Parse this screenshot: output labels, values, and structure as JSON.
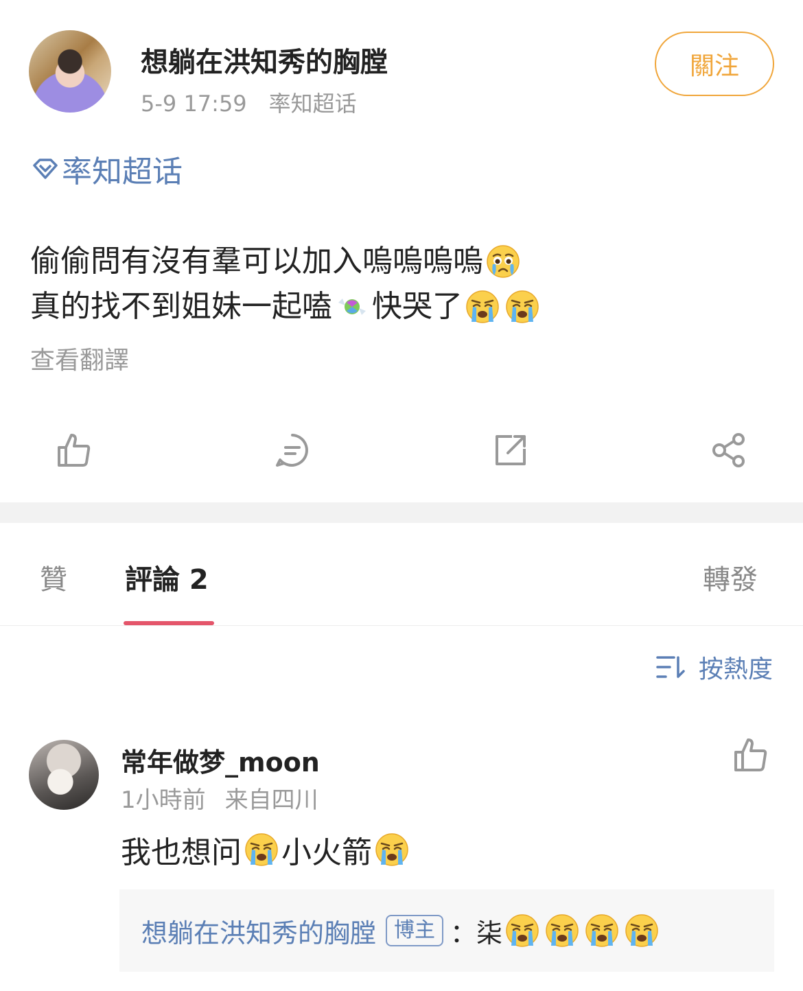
{
  "post": {
    "author_name": "想躺在洪知秀的胸膛",
    "time": "5-9 17:59",
    "source": "率知超话",
    "follow_label": "關注",
    "topic": "率知超话",
    "line1": "偷偷問有沒有羣可以加入嗚嗚嗚嗚",
    "line2a": "真的找不到姐妹一起嗑",
    "line2b": "快哭了",
    "translate_label": "查看翻譯",
    "action_icons": [
      "like-icon",
      "comment-icon",
      "repost-icon",
      "share-icon"
    ]
  },
  "tabs": {
    "likes_label": "贊",
    "comments_label": "評論 2",
    "reposts_label": "轉發"
  },
  "sort": {
    "label": "按熱度"
  },
  "comment": {
    "user": "常年做梦_moon",
    "time": "1小時前",
    "location": "来自四川",
    "text_a": "我也想问",
    "text_b": "小火箭",
    "reply": {
      "user": "想躺在洪知秀的胸膛",
      "badge": "博主",
      "text": "：柒"
    }
  },
  "colors": {
    "link_blue": "#5b7fb5",
    "follow_orange": "#f0a539",
    "tab_underline": "#e4556a",
    "meta_gray": "#999999"
  }
}
